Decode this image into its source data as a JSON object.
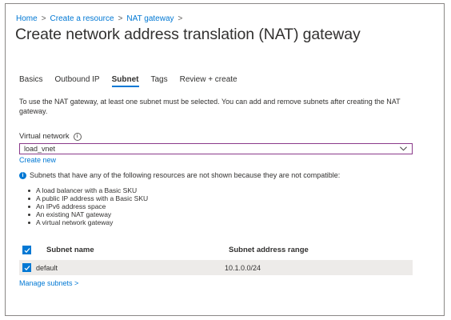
{
  "breadcrumb": {
    "items": [
      "Home",
      "Create a resource",
      "NAT gateway"
    ],
    "separator": ">"
  },
  "page": {
    "title": "Create network address translation (NAT) gateway",
    "more_label": "···"
  },
  "tabs": [
    {
      "label": "Basics",
      "active": false
    },
    {
      "label": "Outbound IP",
      "active": false
    },
    {
      "label": "Subnet",
      "active": true
    },
    {
      "label": "Tags",
      "active": false
    },
    {
      "label": "Review + create",
      "active": false
    }
  ],
  "intro_text": "To use the NAT gateway, at least one subnet must be selected. You can add and remove subnets after creating the NAT gateway.",
  "virtual_network": {
    "label": "Virtual network",
    "info_icon": "i",
    "value": "load_vnet",
    "create_new": "Create new"
  },
  "notice": {
    "icon": "i",
    "text": "Subnets that have any of the following resources are not shown because they are not compatible:",
    "items": [
      "A load balancer with a Basic SKU",
      "A public IP address with a Basic SKU",
      "An IPv6 address space",
      "An existing NAT gateway",
      "A virtual network gateway"
    ]
  },
  "subnet_table": {
    "headers": [
      "Subnet name",
      "Subnet address range"
    ],
    "rows": [
      {
        "name": "default",
        "range": "10.1.0.0/24",
        "checked": true
      }
    ],
    "all_checked": true
  },
  "manage_subnets": "Manage subnets >",
  "colors": {
    "accent": "#0078d4",
    "select_border": "#8a3a8a",
    "row_bg": "#edebe9"
  }
}
